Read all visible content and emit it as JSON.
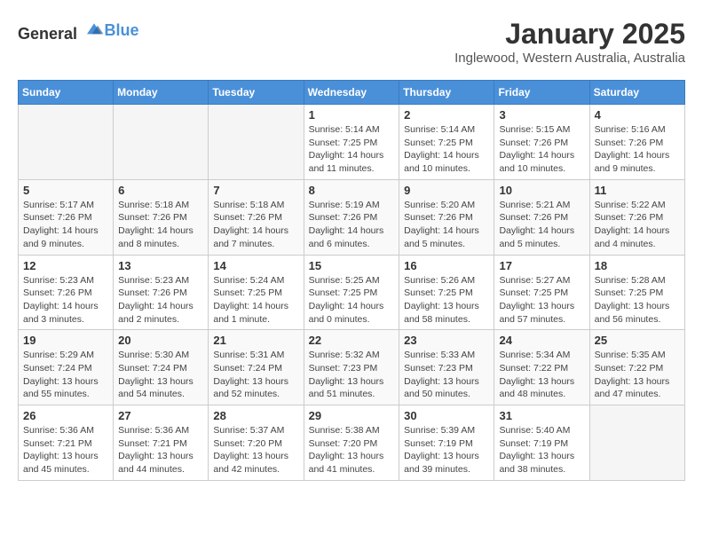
{
  "header": {
    "logo_general": "General",
    "logo_blue": "Blue",
    "title": "January 2025",
    "subtitle": "Inglewood, Western Australia, Australia"
  },
  "weekdays": [
    "Sunday",
    "Monday",
    "Tuesday",
    "Wednesday",
    "Thursday",
    "Friday",
    "Saturday"
  ],
  "weeks": [
    [
      {
        "day": "",
        "info": ""
      },
      {
        "day": "",
        "info": ""
      },
      {
        "day": "",
        "info": ""
      },
      {
        "day": "1",
        "info": "Sunrise: 5:14 AM\nSunset: 7:25 PM\nDaylight: 14 hours and 11 minutes."
      },
      {
        "day": "2",
        "info": "Sunrise: 5:14 AM\nSunset: 7:25 PM\nDaylight: 14 hours and 10 minutes."
      },
      {
        "day": "3",
        "info": "Sunrise: 5:15 AM\nSunset: 7:26 PM\nDaylight: 14 hours and 10 minutes."
      },
      {
        "day": "4",
        "info": "Sunrise: 5:16 AM\nSunset: 7:26 PM\nDaylight: 14 hours and 9 minutes."
      }
    ],
    [
      {
        "day": "5",
        "info": "Sunrise: 5:17 AM\nSunset: 7:26 PM\nDaylight: 14 hours and 9 minutes."
      },
      {
        "day": "6",
        "info": "Sunrise: 5:18 AM\nSunset: 7:26 PM\nDaylight: 14 hours and 8 minutes."
      },
      {
        "day": "7",
        "info": "Sunrise: 5:18 AM\nSunset: 7:26 PM\nDaylight: 14 hours and 7 minutes."
      },
      {
        "day": "8",
        "info": "Sunrise: 5:19 AM\nSunset: 7:26 PM\nDaylight: 14 hours and 6 minutes."
      },
      {
        "day": "9",
        "info": "Sunrise: 5:20 AM\nSunset: 7:26 PM\nDaylight: 14 hours and 5 minutes."
      },
      {
        "day": "10",
        "info": "Sunrise: 5:21 AM\nSunset: 7:26 PM\nDaylight: 14 hours and 5 minutes."
      },
      {
        "day": "11",
        "info": "Sunrise: 5:22 AM\nSunset: 7:26 PM\nDaylight: 14 hours and 4 minutes."
      }
    ],
    [
      {
        "day": "12",
        "info": "Sunrise: 5:23 AM\nSunset: 7:26 PM\nDaylight: 14 hours and 3 minutes."
      },
      {
        "day": "13",
        "info": "Sunrise: 5:23 AM\nSunset: 7:26 PM\nDaylight: 14 hours and 2 minutes."
      },
      {
        "day": "14",
        "info": "Sunrise: 5:24 AM\nSunset: 7:25 PM\nDaylight: 14 hours and 1 minute."
      },
      {
        "day": "15",
        "info": "Sunrise: 5:25 AM\nSunset: 7:25 PM\nDaylight: 14 hours and 0 minutes."
      },
      {
        "day": "16",
        "info": "Sunrise: 5:26 AM\nSunset: 7:25 PM\nDaylight: 13 hours and 58 minutes."
      },
      {
        "day": "17",
        "info": "Sunrise: 5:27 AM\nSunset: 7:25 PM\nDaylight: 13 hours and 57 minutes."
      },
      {
        "day": "18",
        "info": "Sunrise: 5:28 AM\nSunset: 7:25 PM\nDaylight: 13 hours and 56 minutes."
      }
    ],
    [
      {
        "day": "19",
        "info": "Sunrise: 5:29 AM\nSunset: 7:24 PM\nDaylight: 13 hours and 55 minutes."
      },
      {
        "day": "20",
        "info": "Sunrise: 5:30 AM\nSunset: 7:24 PM\nDaylight: 13 hours and 54 minutes."
      },
      {
        "day": "21",
        "info": "Sunrise: 5:31 AM\nSunset: 7:24 PM\nDaylight: 13 hours and 52 minutes."
      },
      {
        "day": "22",
        "info": "Sunrise: 5:32 AM\nSunset: 7:23 PM\nDaylight: 13 hours and 51 minutes."
      },
      {
        "day": "23",
        "info": "Sunrise: 5:33 AM\nSunset: 7:23 PM\nDaylight: 13 hours and 50 minutes."
      },
      {
        "day": "24",
        "info": "Sunrise: 5:34 AM\nSunset: 7:22 PM\nDaylight: 13 hours and 48 minutes."
      },
      {
        "day": "25",
        "info": "Sunrise: 5:35 AM\nSunset: 7:22 PM\nDaylight: 13 hours and 47 minutes."
      }
    ],
    [
      {
        "day": "26",
        "info": "Sunrise: 5:36 AM\nSunset: 7:21 PM\nDaylight: 13 hours and 45 minutes."
      },
      {
        "day": "27",
        "info": "Sunrise: 5:36 AM\nSunset: 7:21 PM\nDaylight: 13 hours and 44 minutes."
      },
      {
        "day": "28",
        "info": "Sunrise: 5:37 AM\nSunset: 7:20 PM\nDaylight: 13 hours and 42 minutes."
      },
      {
        "day": "29",
        "info": "Sunrise: 5:38 AM\nSunset: 7:20 PM\nDaylight: 13 hours and 41 minutes."
      },
      {
        "day": "30",
        "info": "Sunrise: 5:39 AM\nSunset: 7:19 PM\nDaylight: 13 hours and 39 minutes."
      },
      {
        "day": "31",
        "info": "Sunrise: 5:40 AM\nSunset: 7:19 PM\nDaylight: 13 hours and 38 minutes."
      },
      {
        "day": "",
        "info": ""
      }
    ]
  ]
}
